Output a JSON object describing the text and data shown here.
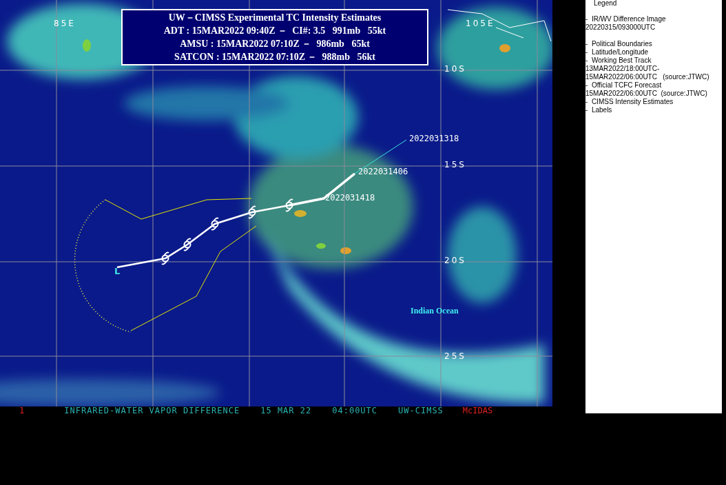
{
  "title_box": {
    "lines": [
      "UW－CIMSS Experimental TC Intensity Estimates",
      "ADT : 15MAR2022 09:40Z －  CI#: 3.5   991mb   55kt",
      "AMSU : 15MAR2022 07:10Z －  986mb   65kt",
      "SATCON : 15MAR2022 07:10Z －  988mb   56kt"
    ]
  },
  "map": {
    "lon_labels": [
      "85E",
      "105E"
    ],
    "lat_labels": [
      "10S",
      "15S",
      "20S",
      "25S"
    ],
    "track_labels": [
      "2022031318",
      "2022031406",
      "2022031418"
    ],
    "region_label": "Indian Ocean",
    "low_marker": "L"
  },
  "status_bar": {
    "frame": "1",
    "product": "INFRARED-WATER VAPOR DIFFERENCE",
    "date": "15 MAR 22",
    "time": "04:00UTC",
    "source": "UW-CIMSS",
    "software": "McIDAS"
  },
  "legend": {
    "title": "Legend",
    "sections": [
      [
        "-  IR/WV Difference Image",
        "20220315/093000UTC"
      ],
      [
        "-  Political Boundaries",
        "-  Latitude/Longitude",
        "-  Working Best Track",
        "13MAR2022/18:00UTC-",
        "15MAR2022/06:00UTC   (source:JTWC)",
        "-  Official TCFC Forecast",
        "15MAR2022/06:00UTC  (source:JTWC)",
        "-  CIMSS Intensity Estimates",
        "-  Labels"
      ]
    ]
  }
}
